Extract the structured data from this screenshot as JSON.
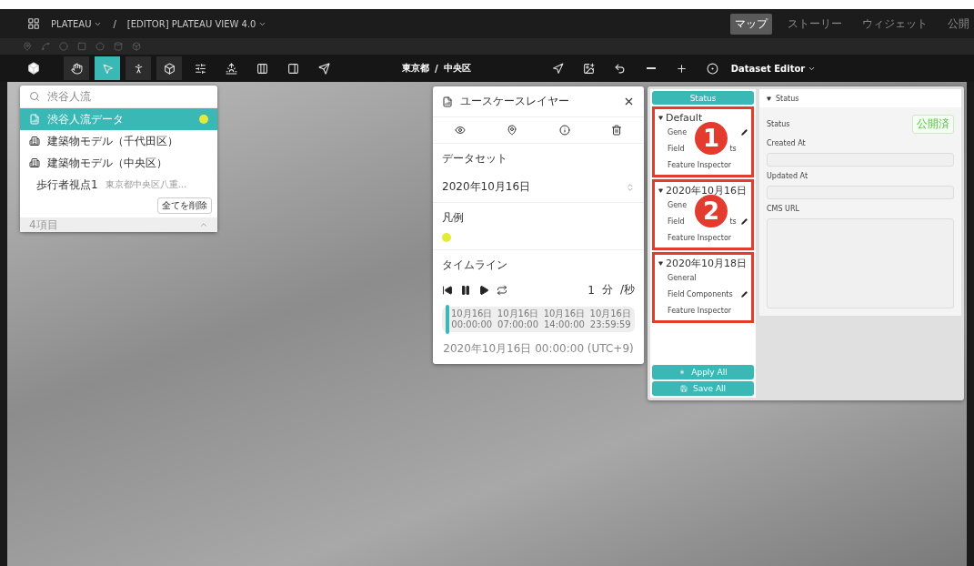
{
  "header": {
    "project": "PLATEAU",
    "separator": "/",
    "scene": "[EDITOR] PLATEAU VIEW 4.0",
    "tabs": [
      {
        "label": "マップ",
        "selected": true
      },
      {
        "label": "ストーリー",
        "selected": false
      },
      {
        "label": "ウィジェット",
        "selected": false
      },
      {
        "label": "公開",
        "selected": false
      }
    ]
  },
  "toolbar": {
    "tools": [
      {
        "kind": "hand",
        "selected": false
      },
      {
        "kind": "pointer",
        "selected": true
      },
      {
        "kind": "pedestrian",
        "selected": false
      },
      {
        "kind": "box",
        "selected": false
      }
    ],
    "breadcrumb": [
      "東京都",
      "/",
      "中央区"
    ],
    "editor_menu": "Dataset Editor"
  },
  "layer_list": {
    "search": "渋谷人流",
    "items": [
      {
        "kind": "data",
        "label": "渋谷人流データ",
        "selected": true,
        "color": "#e3ea3a"
      },
      {
        "kind": "building",
        "label": "建築物モデル（千代田区）",
        "selected": false
      },
      {
        "kind": "building",
        "label": "建築物モデル（中央区）",
        "selected": false
      },
      {
        "kind": "pedestrian",
        "label": "歩行者視点1",
        "address": "東京都中央区八重...",
        "selected": false
      }
    ],
    "remove_all": "全てを削除",
    "count": "4項目"
  },
  "layer_panel": {
    "title": "ユースケースレイヤー",
    "dataset_label": "データセット",
    "dataset_value": "2020年10月16日",
    "legend_label": "凡例",
    "legend": [
      {
        "color": "#e3ea3a"
      }
    ],
    "timeline_label": "タイムライン",
    "speed": "1",
    "unit": "分",
    "per": "/秒",
    "ticks": [
      {
        "date": "10月16日",
        "time": "00:00:00"
      },
      {
        "date": "10月16日",
        "time": "07:00:00"
      },
      {
        "date": "10月16日",
        "time": "14:00:00"
      },
      {
        "date": "10月16日",
        "time": "23:59:59"
      }
    ],
    "level": 0.01,
    "current": "2020年10月16日 00:00:00 (UTC+9)"
  },
  "dataset_editor": {
    "status_tab": {
      "label": "Status",
      "selected": true
    },
    "groups": [
      {
        "title": "Default",
        "highlighted": true,
        "callout": "1",
        "items": [
          {
            "label": "Gene",
            "edited": true
          },
          {
            "label": "Field",
            "tail": "ts",
            "edited": false
          },
          {
            "label": "Feature Inspector",
            "edited": false
          }
        ]
      },
      {
        "title": "2020年10月16日",
        "highlighted": true,
        "callout": "2",
        "items": [
          {
            "label": "Gene",
            "edited": false
          },
          {
            "label": "Field",
            "tail": "ts",
            "edited": true
          },
          {
            "label": "Feature Inspector",
            "edited": false
          }
        ]
      },
      {
        "title": "2020年10月18日",
        "highlighted": true,
        "items": [
          {
            "label": "General",
            "edited": false
          },
          {
            "label": "Field Components",
            "edited": true
          },
          {
            "label": "Feature Inspector",
            "edited": false
          }
        ]
      }
    ],
    "apply_all": "Apply All",
    "save_all": "Save All",
    "section": {
      "title": "Status",
      "expanded": true,
      "status_label": "Status",
      "status_badge": "公開済",
      "created_label": "Created At",
      "updated_label": "Updated At",
      "cms_label": "CMS URL"
    }
  }
}
